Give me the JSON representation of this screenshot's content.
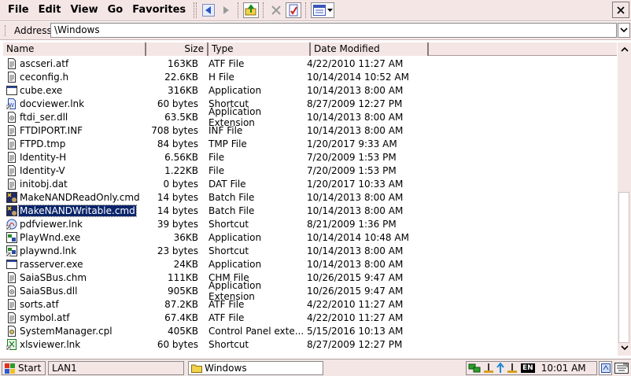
{
  "menu": {
    "file": "File",
    "edit": "Edit",
    "view": "View",
    "go": "Go",
    "favorites": "Favorites"
  },
  "address": {
    "label": "Address",
    "value": "\\Windows"
  },
  "columns": {
    "name": "Name",
    "size": "Size",
    "type": "Type",
    "date": "Date Modified"
  },
  "files": [
    {
      "name": "ascseri.atf",
      "size": "163KB",
      "type": "ATF File",
      "date": "4/22/2010 11:27 AM",
      "icon": "file-text-icon"
    },
    {
      "name": "ceconfig.h",
      "size": "22.6KB",
      "type": "H File",
      "date": "10/14/2014 10:52 AM",
      "icon": "file-text-icon"
    },
    {
      "name": "cube.exe",
      "size": "316KB",
      "type": "Application",
      "date": "10/14/2013 8:00 AM",
      "icon": "application-icon"
    },
    {
      "name": "docviewer.lnk",
      "size": "60 bytes",
      "type": "Shortcut",
      "date": "8/27/2009 12:27 PM",
      "icon": "doc-shortcut-icon"
    },
    {
      "name": "ftdi_ser.dll",
      "size": "63.5KB",
      "type": "Application Extension",
      "date": "10/14/2013 8:00 AM",
      "icon": "dll-file-icon"
    },
    {
      "name": "FTDIPORT.INF",
      "size": "708 bytes",
      "type": "INF File",
      "date": "10/14/2013 8:00 AM",
      "icon": "file-text-icon"
    },
    {
      "name": "FTPD.tmp",
      "size": "84 bytes",
      "type": "TMP File",
      "date": "1/20/2017 9:33 AM",
      "icon": "file-text-icon"
    },
    {
      "name": "Identity-H",
      "size": "6.56KB",
      "type": "File",
      "date": "7/20/2009 1:53 PM",
      "icon": "file-text-icon"
    },
    {
      "name": "Identity-V",
      "size": "1.22KB",
      "type": "File",
      "date": "7/20/2009 1:53 PM",
      "icon": "file-text-icon"
    },
    {
      "name": "initobj.dat",
      "size": "0 bytes",
      "type": "DAT File",
      "date": "1/20/2017 10:33 AM",
      "icon": "file-text-icon"
    },
    {
      "name": "MakeNANDReadOnly.cmd",
      "size": "14 bytes",
      "type": "Batch File",
      "date": "10/14/2013 8:00 AM",
      "icon": "batch-file-icon"
    },
    {
      "name": "MakeNANDWritable.cmd",
      "size": "14 bytes",
      "type": "Batch File",
      "date": "10/14/2013 8:00 AM",
      "icon": "batch-file-icon",
      "selected": true
    },
    {
      "name": "pdfviewer.lnk",
      "size": "39 bytes",
      "type": "Shortcut",
      "date": "8/21/2009 1:36 PM",
      "icon": "pdf-shortcut-icon"
    },
    {
      "name": "PlayWnd.exe",
      "size": "36KB",
      "type": "Application",
      "date": "10/14/2014 10:48 AM",
      "icon": "media-app-icon"
    },
    {
      "name": "playwnd.lnk",
      "size": "23 bytes",
      "type": "Shortcut",
      "date": "10/14/2013 8:00 AM",
      "icon": "media-shortcut-icon"
    },
    {
      "name": "rasserver.exe",
      "size": "24KB",
      "type": "Application",
      "date": "10/14/2013 8:00 AM",
      "icon": "application-icon"
    },
    {
      "name": "SaiaSBus.chm",
      "size": "111KB",
      "type": "CHM File",
      "date": "10/26/2015 9:47 AM",
      "icon": "file-text-icon"
    },
    {
      "name": "SaiaSBus.dll",
      "size": "905KB",
      "type": "Application Extension",
      "date": "10/26/2015 9:47 AM",
      "icon": "dll-file-icon"
    },
    {
      "name": "sorts.atf",
      "size": "87.2KB",
      "type": "ATF File",
      "date": "4/22/2010 11:27 AM",
      "icon": "file-text-icon"
    },
    {
      "name": "symbol.atf",
      "size": "67.4KB",
      "type": "ATF File",
      "date": "4/22/2010 11:27 AM",
      "icon": "file-text-icon"
    },
    {
      "name": "SystemManager.cpl",
      "size": "405KB",
      "type": "Control Panel exte...",
      "date": "5/15/2016 10:13 AM",
      "icon": "control-panel-icon"
    },
    {
      "name": "xlsviewer.lnk",
      "size": "60 bytes",
      "type": "Shortcut",
      "date": "8/27/2009 12:27 PM",
      "icon": "xls-shortcut-icon"
    }
  ],
  "taskbar": {
    "start": "Start",
    "task1": "LAN1",
    "task2": "Windows",
    "lang": "EN",
    "clock": "10:01 AM"
  },
  "colors": {
    "chrome": "#f5e6e6",
    "selection": "#0a246a"
  }
}
